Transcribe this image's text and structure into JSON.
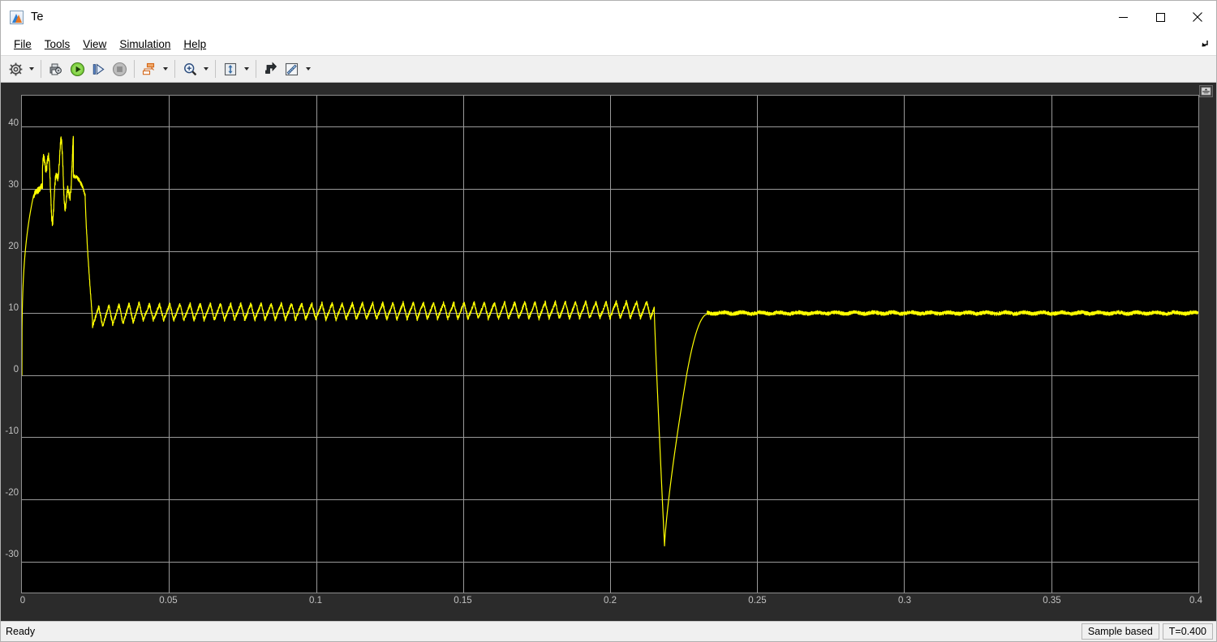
{
  "window": {
    "title": "Te",
    "icon": "matlab-icon",
    "minimize_label": "Minimize",
    "maximize_label": "Maximize",
    "close_label": "Close"
  },
  "menubar": {
    "items": [
      {
        "label": "File",
        "mnemonic": "F"
      },
      {
        "label": "Tools",
        "mnemonic": "T"
      },
      {
        "label": "View",
        "mnemonic": "V"
      },
      {
        "label": "Simulation",
        "mnemonic": "i"
      },
      {
        "label": "Help",
        "mnemonic": "H"
      }
    ],
    "collapse_icon": "collapse-ribbon-icon"
  },
  "toolbar": {
    "buttons": [
      {
        "name": "configuration-properties-icon",
        "tooltip": "Configuration Properties",
        "has_dropdown": true
      },
      {
        "name": "print-icon",
        "tooltip": "Print",
        "has_dropdown": false
      },
      {
        "name": "run-icon",
        "tooltip": "Run",
        "has_dropdown": false
      },
      {
        "name": "step-forward-icon",
        "tooltip": "Step Forward",
        "has_dropdown": false
      },
      {
        "name": "stop-icon",
        "tooltip": "Stop",
        "has_dropdown": false
      },
      {
        "name": "signal-selection-icon",
        "tooltip": "Signal Selection",
        "has_dropdown": true
      },
      {
        "name": "zoom-in-icon",
        "tooltip": "Zoom In",
        "has_dropdown": true
      },
      {
        "name": "autoscale-icon",
        "tooltip": "Autoscale",
        "has_dropdown": true
      },
      {
        "name": "trigger-icon",
        "tooltip": "Trigger",
        "has_dropdown": false
      },
      {
        "name": "measurements-icon",
        "tooltip": "Measurements",
        "has_dropdown": true
      }
    ]
  },
  "plot": {
    "panel_expand_icon": "expand-panel-icon",
    "trace_color": "#ffff00",
    "background_color": "#000000",
    "grid_color": "#9a9a9a",
    "axes_frame_color": "#8f8f8f",
    "surround_color": "#2b2b2b"
  },
  "statusbar": {
    "status": "Ready",
    "frame_mode": "Sample based",
    "time": "T=0.400"
  },
  "chart_data": {
    "type": "line",
    "title": "Te",
    "xlabel": "",
    "ylabel": "",
    "xlim": [
      0,
      0.4
    ],
    "ylim": [
      -35,
      45
    ],
    "xticks": [
      0,
      0.05,
      0.1,
      0.15,
      0.2,
      0.25,
      0.3,
      0.35,
      0.4
    ],
    "xtick_labels": [
      "0",
      "0.05",
      "0.1",
      "0.15",
      "0.2",
      "0.25",
      "0.3",
      "0.35",
      "0.4"
    ],
    "yticks": [
      40,
      30,
      20,
      10,
      0,
      -10,
      -20,
      -30
    ],
    "ytick_labels": [
      "40",
      "30",
      "20",
      "10",
      "0",
      "-10",
      "-20",
      "-30"
    ],
    "grid": true,
    "legend": null,
    "series": [
      {
        "name": "Te",
        "color": "#ffff00",
        "description": "Electromagnetic torque of an induction machine: startup transient peaking near 37 N.m, settling to ~10 N.m with switching ripple, a load disturbance dip to about -27.5 N.m near t=0.218 s, then a smooth low-ripple steady state at 10 N.m.",
        "segments": [
          {
            "t_start": 0.0,
            "t_end": 0.004,
            "mean_start": 0,
            "mean_end": 29,
            "ripple": 0.0,
            "shape": "rise"
          },
          {
            "t_start": 0.004,
            "t_end": 0.007,
            "mean_start": 29,
            "mean_end": 30.5,
            "ripple": 0.5,
            "shape": "plateau"
          },
          {
            "t_start": 0.007,
            "t_end": 0.0175,
            "mean_start": 31,
            "mean_end": 32,
            "ripple": 4.5,
            "shape": "oscillate"
          },
          {
            "t_start": 0.0175,
            "t_end": 0.0215,
            "mean_start": 32,
            "mean_end": 29,
            "ripple": 0.6,
            "shape": "knee"
          },
          {
            "t_start": 0.0215,
            "t_end": 0.024,
            "mean_start": 29,
            "mean_end": 9,
            "ripple": 0.4,
            "shape": "fall"
          },
          {
            "t_start": 0.024,
            "t_end": 0.04,
            "mean_start": 9.2,
            "mean_end": 10.0,
            "ripple": 1.6,
            "shape": "ripple"
          },
          {
            "t_start": 0.04,
            "t_end": 0.215,
            "mean_start": 10.0,
            "mean_end": 10.4,
            "ripple": 1.3,
            "shape": "ripple"
          },
          {
            "t_start": 0.215,
            "t_end": 0.2185,
            "mean_start": 10.4,
            "mean_end": -27.5,
            "ripple": 0.0,
            "shape": "dip-down"
          },
          {
            "t_start": 0.2185,
            "t_end": 0.226,
            "mean_start": -27.5,
            "mean_end": 0,
            "ripple": 0.0,
            "shape": "dip-up"
          },
          {
            "t_start": 0.226,
            "t_end": 0.233,
            "mean_start": 0,
            "mean_end": 9.8,
            "ripple": 0.0,
            "shape": "recover"
          },
          {
            "t_start": 0.233,
            "t_end": 0.4,
            "mean_start": 10.0,
            "mean_end": 10.0,
            "ripple": 0.28,
            "shape": "noise"
          }
        ],
        "key_points": [
          {
            "t": 0.0,
            "y": 0.0,
            "note": "start"
          },
          {
            "t": 0.008,
            "y": 35.3,
            "note": "first overshoot peak"
          },
          {
            "t": 0.01,
            "y": 30.7,
            "note": "local minimum"
          },
          {
            "t": 0.0125,
            "y": 34.2,
            "note": "second peak"
          },
          {
            "t": 0.0145,
            "y": 36.8,
            "note": "maximum"
          },
          {
            "t": 0.022,
            "y": 10.0,
            "note": "settle to rated torque"
          },
          {
            "t": 0.026,
            "y": 7.6,
            "note": "ripple minimum after settling"
          },
          {
            "t": 0.215,
            "y": 11.2,
            "note": "last ripple peak before disturbance"
          },
          {
            "t": 0.2185,
            "y": -27.5,
            "note": "disturbance minimum"
          },
          {
            "t": 0.234,
            "y": 10.2,
            "note": "recovered"
          },
          {
            "t": 0.4,
            "y": 10.0,
            "note": "end steady state"
          }
        ]
      }
    ]
  }
}
